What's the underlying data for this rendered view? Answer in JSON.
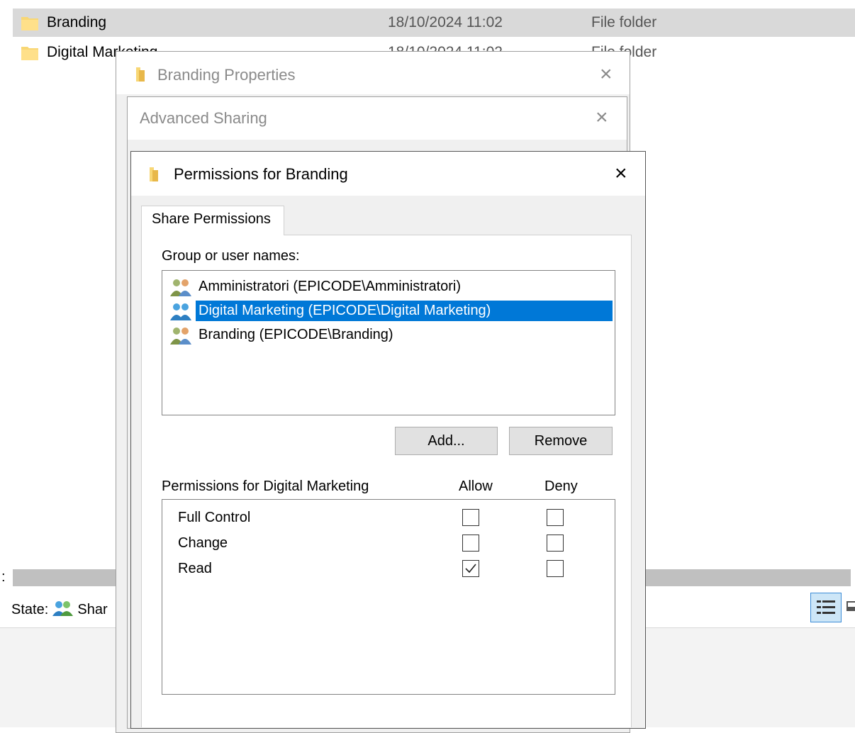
{
  "explorer": {
    "rows": [
      {
        "name": "Branding",
        "date": "18/10/2024 11:02",
        "type": "File folder"
      },
      {
        "name": "Digital Marketing",
        "date": "18/10/2024 11:02",
        "type": "File folder"
      }
    ],
    "status_label": "State:",
    "status_value": "Shar",
    "colon_marker": ":"
  },
  "properties_dialog": {
    "title": "Branding Properties",
    "close_glyph": "×"
  },
  "advanced_sharing": {
    "title": "Advanced Sharing",
    "close_glyph": "×"
  },
  "permissions_dialog": {
    "title": "Permissions for Branding",
    "close_glyph": "×",
    "tab": "Share Permissions",
    "group_label": "Group or user names:",
    "users": [
      {
        "name": "Amministratori (EPICODE\\Amministratori)",
        "selected": false
      },
      {
        "name": "Digital Marketing (EPICODE\\Digital Marketing)",
        "selected": true
      },
      {
        "name": "Branding (EPICODE\\Branding)",
        "selected": false
      }
    ],
    "add_button": "Add...",
    "remove_button": "Remove",
    "perm_header": "Permissions for Digital Marketing",
    "allow_header": "Allow",
    "deny_header": "Deny",
    "permissions": [
      {
        "name": "Full Control",
        "allow": false,
        "deny": false
      },
      {
        "name": "Change",
        "allow": false,
        "deny": false
      },
      {
        "name": "Read",
        "allow": true,
        "deny": false
      }
    ]
  },
  "colors": {
    "selection": "#0078d7",
    "folder": "#f8d775",
    "dialog_bg": "#f0f0f0"
  }
}
